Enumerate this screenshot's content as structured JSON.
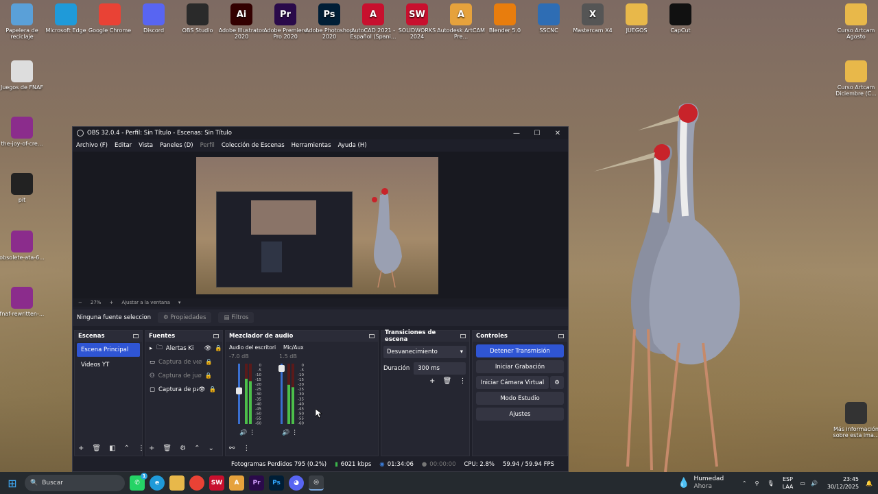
{
  "desktop_icons": [
    {
      "label": "Papelera de reciclaje",
      "icon": "recycle-bin-icon",
      "color": "#5aa0d8"
    },
    {
      "label": "Microsoft Edge",
      "icon": "edge-icon",
      "color": "#1f9ad9"
    },
    {
      "label": "Google Chrome",
      "icon": "chrome-icon",
      "color": "#e94235"
    },
    {
      "label": "Discord",
      "icon": "discord-icon",
      "color": "#5865f2"
    },
    {
      "label": "OBS Studio",
      "icon": "obs-icon",
      "color": "#2a2a2a"
    },
    {
      "label": "Adobe Illustrator 2020",
      "icon": "illustrator-icon",
      "color": "#330000",
      "glyph": "Ai"
    },
    {
      "label": "Adobe Premiere Pro 2020",
      "icon": "premiere-icon",
      "color": "#2a0a4a",
      "glyph": "Pr"
    },
    {
      "label": "Adobe Photoshop 2020",
      "icon": "photoshop-icon",
      "color": "#001e36",
      "glyph": "Ps"
    },
    {
      "label": "AutoCAD 2021 - Español (Spani...",
      "icon": "autocad-icon",
      "color": "#c8102e",
      "glyph": "A"
    },
    {
      "label": "SOLIDWORKS 2024",
      "icon": "solidworks-icon",
      "color": "#c8102e",
      "glyph": "SW"
    },
    {
      "label": "Autodesk ArtCAM Pre...",
      "icon": "artcam-icon",
      "color": "#e6a23c",
      "glyph": "A"
    },
    {
      "label": "Blender 5.0",
      "icon": "blender-icon",
      "color": "#e87d0d"
    },
    {
      "label": "SSCNC",
      "icon": "sscnc-icon",
      "color": "#2e6db4"
    },
    {
      "label": "Mastercam X4",
      "icon": "mastercam-icon",
      "color": "#555555",
      "glyph": "X"
    },
    {
      "label": "JUEGOS",
      "icon": "folder-icon",
      "color": "#e8b84a"
    },
    {
      "label": "CapCut",
      "icon": "capcut-icon",
      "color": "#111111"
    }
  ],
  "desktop_icons_left": [
    {
      "label": "Juegos de FNAF",
      "icon": "document-icon",
      "color": "#dddddd"
    },
    {
      "label": "the-joy-of-cre...",
      "icon": "winrar-icon",
      "color": "#8b2c8c"
    },
    {
      "label": "pit",
      "icon": "pit-icon",
      "color": "#222222"
    },
    {
      "label": "obsolete-ata-6...",
      "icon": "winrar-icon",
      "color": "#8b2c8c"
    },
    {
      "label": "fnaf-rewritten-...",
      "icon": "winrar-icon",
      "color": "#8b2c8c"
    }
  ],
  "desktop_icons_right": [
    {
      "label": "Curso Artcam Agosto",
      "icon": "folder-icon",
      "color": "#e8b84a"
    },
    {
      "label": "Curso Artcam Diciembre (C...",
      "icon": "folder-icon",
      "color": "#e8b84a"
    },
    {
      "label": "Más información sobre esta ima...",
      "icon": "info-icon",
      "color": "#333333"
    }
  ],
  "obs": {
    "title": "OBS 32.0.4 - Perfil: Sin Título - Escenas: Sin Título",
    "menu": [
      "Archivo (F)",
      "Editar",
      "Vista",
      "Paneles (D)",
      "Perfil",
      "Colección de Escenas",
      "Herramientas",
      "Ayuda (H)"
    ],
    "zoom": "27%",
    "fit_label": "Ajustar a la ventana",
    "no_source": "Ninguna fuente seleccionada",
    "properties": "Propiedades",
    "filters": "Filtros",
    "scenes_title": "Escenas",
    "scenes": [
      "Escena Principal",
      "Videos YT"
    ],
    "sources_title": "Fuentes",
    "sources": [
      "Alertas Ki",
      "Captura de ve",
      "Captura de ju",
      "Captura de pa"
    ],
    "mixer_title": "Mezclador de audio",
    "mixer": [
      {
        "name": "Audio del escritorio",
        "db": "-7.0 dB",
        "volume": 0.55,
        "level": 0.75
      },
      {
        "name": "Mic/Aux",
        "db": "1.5 dB",
        "volume": 0.92,
        "level": 0.65
      }
    ],
    "meter_scale": [
      "0",
      "-5",
      "-10",
      "-15",
      "-20",
      "-25",
      "-30",
      "-35",
      "-40",
      "-45",
      "-50",
      "-55",
      "-60"
    ],
    "transitions_title": "Transiciones de escena",
    "transition": "Desvanecimiento",
    "duration_label": "Duración",
    "duration": "300 ms",
    "controls_title": "Controles",
    "controls": [
      "Detener Transmisión",
      "Iniciar Grabación",
      "Iniciar Cámara Virtual",
      "Modo Estudio",
      "Ajustes"
    ],
    "status": {
      "dropped": "Fotogramas Perdidos 795 (0.2%)",
      "bitrate": "6021 kbps",
      "live_time": "01:34:06",
      "rec_time": "00:00:00",
      "cpu": "CPU: 2.8%",
      "fps": "59.94 / 59.94 FPS"
    }
  },
  "taskbar": {
    "search": "Buscar",
    "weather_title": "Humedad",
    "weather_sub": "Ahora",
    "lang1": "ESP",
    "lang2": "LAA",
    "time": "23:45",
    "date": "30/12/2025",
    "badge": "1"
  }
}
